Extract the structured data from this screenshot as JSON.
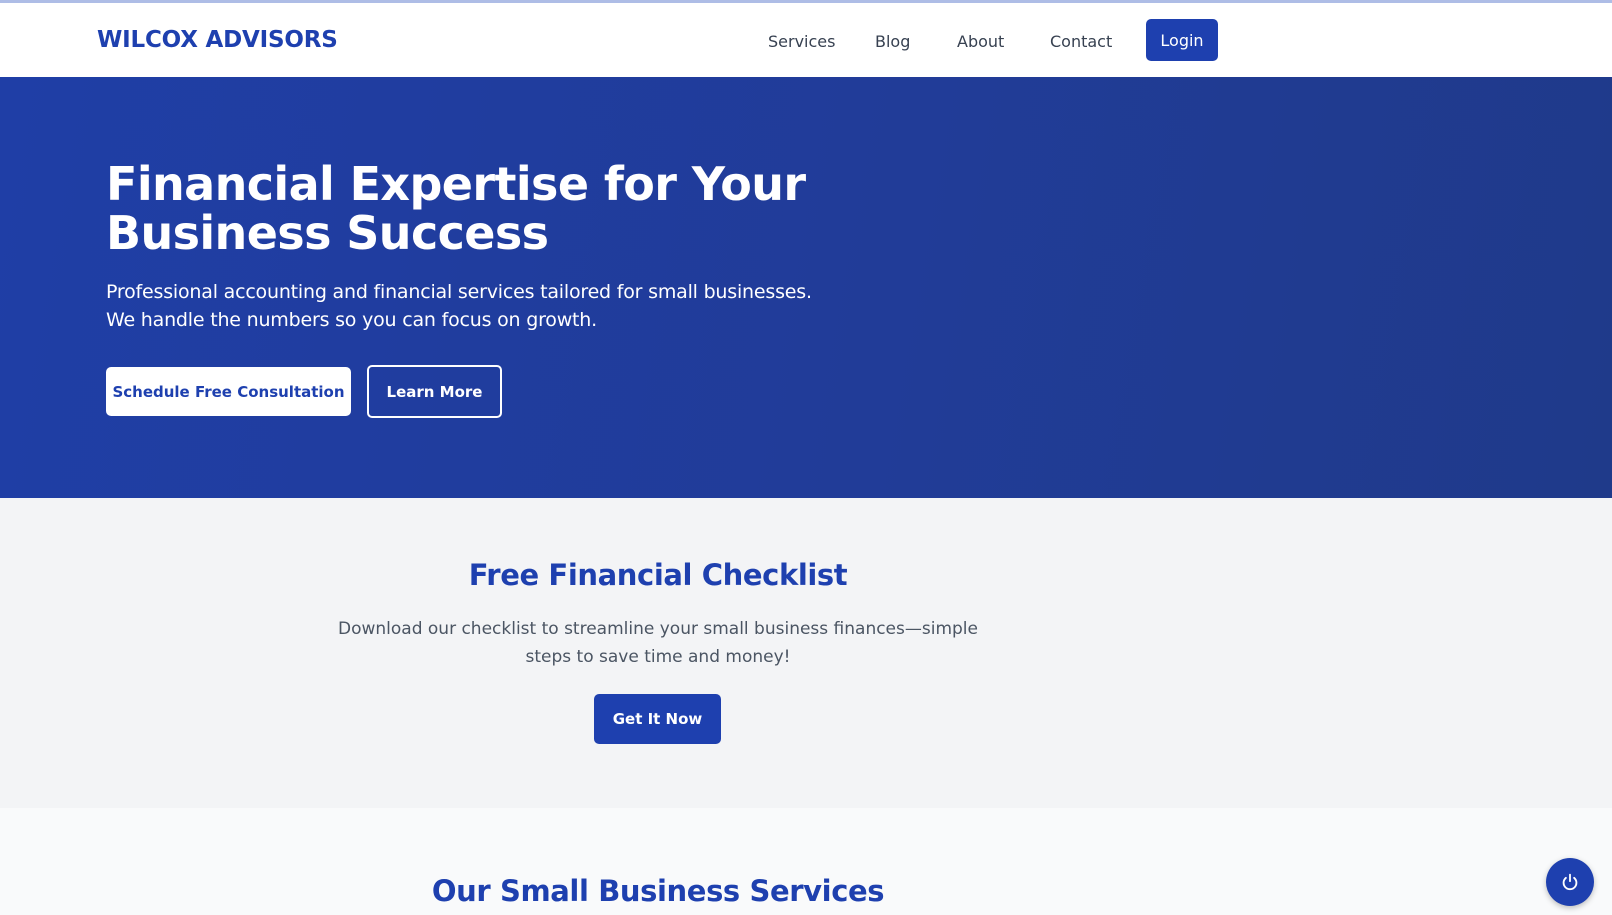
{
  "header": {
    "brand": "WILCOX ADVISORS",
    "nav": [
      "Services",
      "Blog",
      "About",
      "Contact"
    ],
    "login_label": "Login"
  },
  "hero": {
    "title": "Financial Expertise for Your Business Success",
    "subtitle": "Professional accounting and financial services tailored for small businesses. We handle the numbers so you can focus on growth.",
    "primary_cta": "Schedule Free Consultation",
    "secondary_cta": "Learn More"
  },
  "checklist": {
    "title": "Free Financial Checklist",
    "text": "Download our checklist to streamline your small business finances—simple steps to save time and money!",
    "cta": "Get It Now"
  },
  "services": {
    "title": "Our Small Business Services"
  },
  "floating_button": {
    "icon": "power-icon"
  },
  "colors": {
    "brand_blue": "#1e40af",
    "hero_bg": "#213c98",
    "checklist_bg": "#f3f4f6",
    "services_bg": "#f9fafb"
  }
}
